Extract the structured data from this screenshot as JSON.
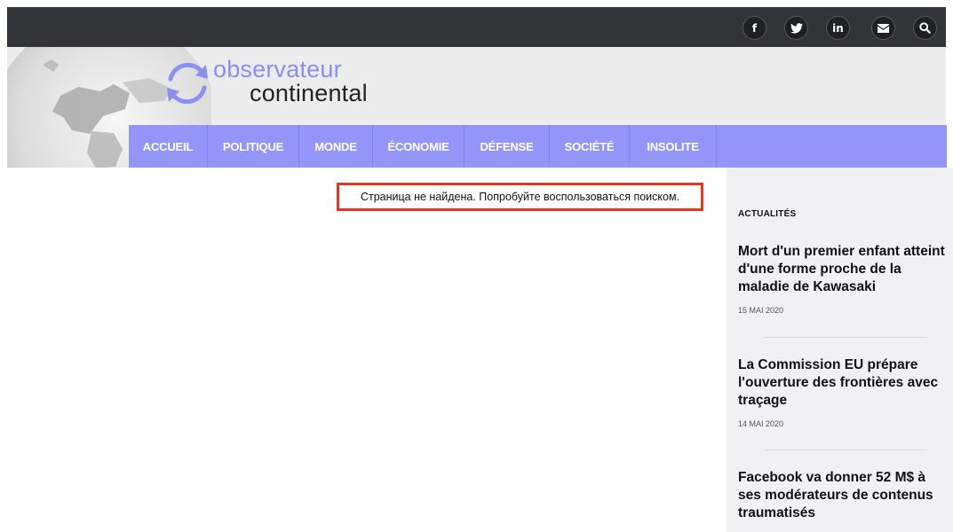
{
  "topbar": {
    "icons": [
      {
        "name": "facebook-icon",
        "glyph": "f"
      },
      {
        "name": "twitter-icon",
        "glyph": "🐦"
      },
      {
        "name": "linkedin-icon",
        "glyph": "in"
      },
      {
        "name": "email-icon",
        "glyph": "✉"
      },
      {
        "name": "search-icon",
        "glyph": "⚲"
      }
    ]
  },
  "logo": {
    "line1": "observateur",
    "line2": "continental"
  },
  "nav": {
    "items": [
      "ACCUEIL",
      "POLITIQUE",
      "MONDE",
      "ÉCONOMIE",
      "DÉFENSE",
      "SOCIÉTÉ",
      "INSOLITE"
    ]
  },
  "main": {
    "notice": "Страница не найдена. Попробуйте воспользоваться поиском."
  },
  "sidebar": {
    "heading": "ACTUALITÉS",
    "articles": [
      {
        "title": "Mort d'un premier enfant atteint d'une forme proche de la maladie de Kawasaki",
        "date": "15 MAI 2020"
      },
      {
        "title": "La Commission EU prépare l'ouverture des frontières avec traçage",
        "date": "14 MAI 2020"
      },
      {
        "title": "Facebook va donner 52 M$ à ses modérateurs de contenus traumatisés",
        "date": ""
      }
    ]
  },
  "colors": {
    "nav_bg": "#9495f8",
    "topbar_bg": "#333438",
    "notice_border": "#e8361f",
    "logo_accent": "#8d8ef2"
  }
}
